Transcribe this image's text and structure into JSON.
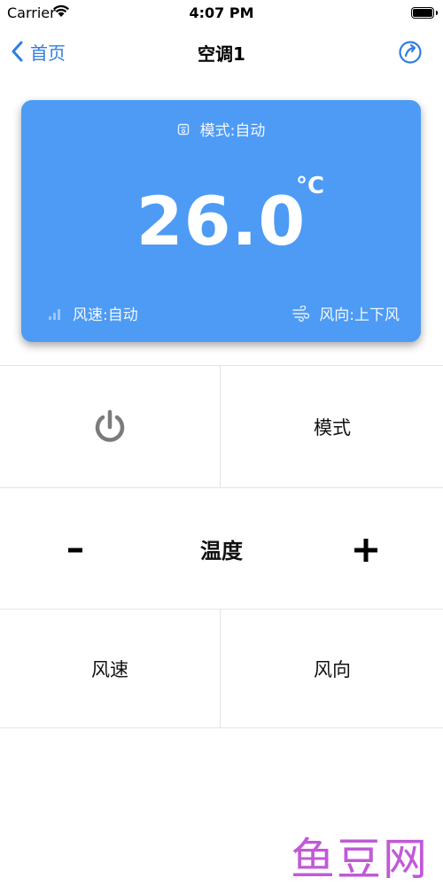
{
  "status_bar": {
    "carrier": "Carrier",
    "time": "4:07 PM"
  },
  "nav": {
    "back_label": "首页",
    "title": "空调1",
    "accent_color": "#2f7de1"
  },
  "ac_status": {
    "mode_text": "模式:自动",
    "temperature": "26.0",
    "unit": "°C",
    "fan_speed_text": "风速:自动",
    "fan_direction_text": "风向:上下风",
    "card_color": "#4d9bf4"
  },
  "controls": {
    "power_icon": "power-icon",
    "mode_label": "模式",
    "temp_label": "温度",
    "minus_label": "-",
    "plus_label": "+",
    "fan_speed_label": "风速",
    "fan_direction_label": "风向"
  },
  "watermark": {
    "text": "鱼豆网",
    "color": "#c05ad6"
  }
}
